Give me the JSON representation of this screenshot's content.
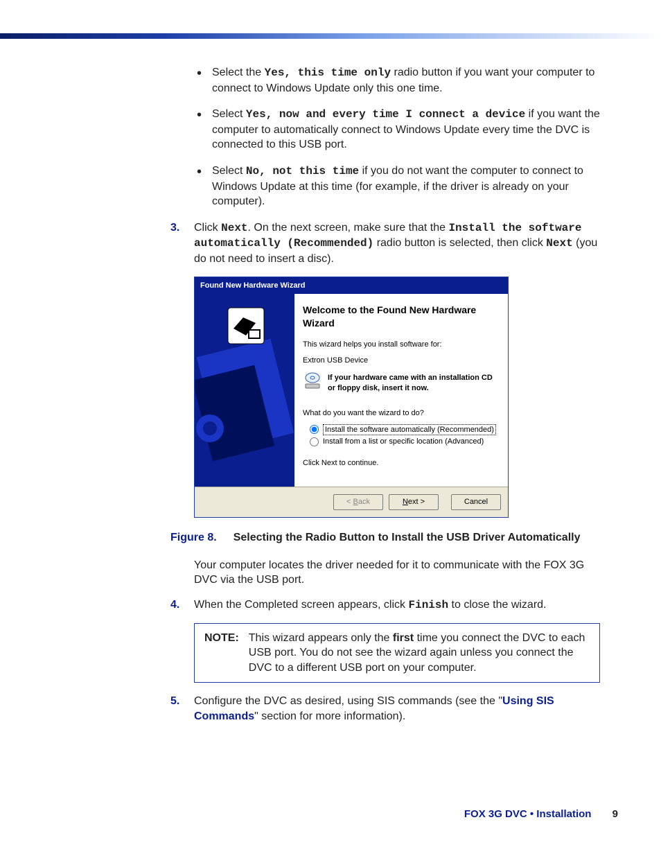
{
  "bullets": [
    {
      "lead": "Select the ",
      "mono": "Yes, this time only",
      "tail": " radio button if you want your computer to connect to Windows Update only this one time."
    },
    {
      "lead": "Select ",
      "mono": "Yes, now and every time I connect a device",
      "tail": " if you want the computer to automatically connect to Windows Update every time the DVC is connected to this USB port."
    },
    {
      "lead": "Select ",
      "mono": "No, not this time",
      "tail": " if you do not want the computer to connect to Windows Update at this time (for example, if the driver is already on your computer)."
    }
  ],
  "step3": {
    "num": "3.",
    "a": "Click ",
    "mono1": "Next",
    "b": ". On the next screen, make sure that the ",
    "mono2": "Install the software automatically (Recommended)",
    "c": " radio button is selected, then click ",
    "mono3": "Next",
    "d": " (you do not need to insert a disc)."
  },
  "wizard": {
    "title": "Found New Hardware Wizard",
    "heading": "Welcome to the Found New Hardware Wizard",
    "p1": "This wizard helps you install software for:",
    "device": "Extron USB Device",
    "cdline": "If your hardware came with an installation CD or floppy disk, insert it now.",
    "question": "What do you want the wizard to do?",
    "opt1": "Install the software automatically (Recommended)",
    "opt2": "Install from a list or specific location (Advanced)",
    "cont": "Click Next to continue.",
    "back_pre": "< ",
    "back_u": "B",
    "back_post": "ack",
    "next_u": "N",
    "next_post": "ext >",
    "cancel": "Cancel"
  },
  "figure": {
    "label": "Figure 8.",
    "caption": "Selecting the Radio Button to Install the USB Driver Automatically"
  },
  "after_fig": "Your computer locates the driver needed for it to communicate with the FOX 3G DVC via the USB port.",
  "step4": {
    "num": "4.",
    "a": "When the Completed screen appears, click ",
    "mono": "Finish",
    "b": " to close the wizard."
  },
  "note": {
    "label": "NOTE:",
    "a": "This wizard appears only the ",
    "bold": "first",
    "b": " time you connect the DVC to each USB port. You do not see the wizard again unless you connect the DVC to a different USB port on your computer."
  },
  "step5": {
    "num": "5.",
    "a": "Configure the DVC as desired, using SIS commands (see the \"",
    "link": "Using SIS Commands",
    "b": "\" section for more information)."
  },
  "footer": {
    "brand": "FOX 3G DVC • Installation",
    "page": "9"
  }
}
